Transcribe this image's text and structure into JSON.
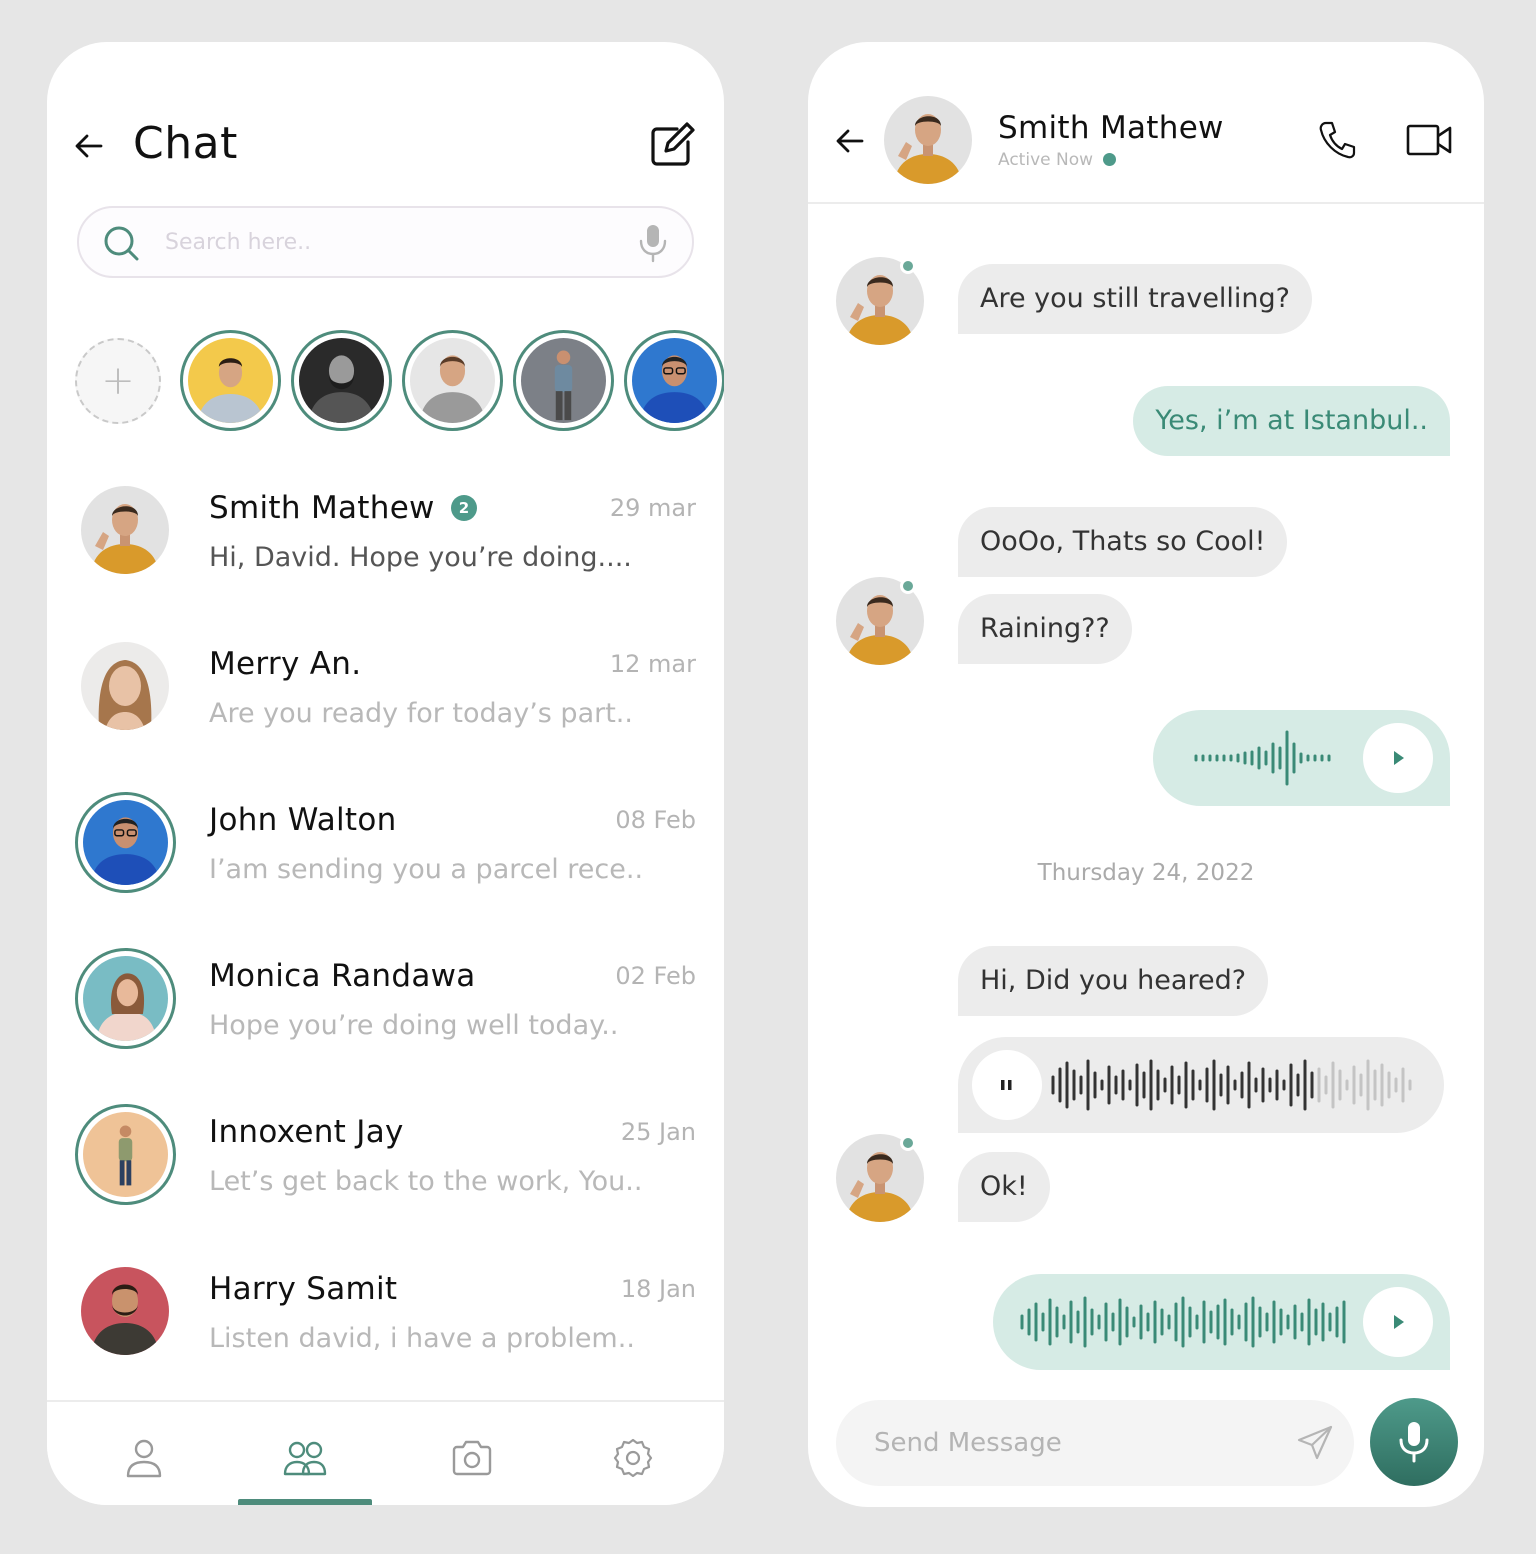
{
  "left": {
    "title": "Chat",
    "search": {
      "placeholder": "Search here.."
    },
    "stories": [
      {
        "name": "story-1",
        "bg": "#f2c84a"
      },
      {
        "name": "story-2",
        "bg": "#3a3a3a"
      },
      {
        "name": "story-3",
        "bg": "#e3e3e3"
      },
      {
        "name": "story-4",
        "bg": "#7b7f85"
      },
      {
        "name": "story-5",
        "bg": "#3f8ee0"
      }
    ],
    "chats": [
      {
        "name": "Smith Mathew",
        "badge": "2",
        "date": "29 mar",
        "preview": "Hi, David. Hope you’re doing....",
        "unread": true
      },
      {
        "name": "Merry An.",
        "date": "12 mar",
        "preview": "Are you ready for today’s part.."
      },
      {
        "name": "John Walton",
        "date": "08 Feb",
        "preview": "I’am sending you a parcel rece.."
      },
      {
        "name": "Monica Randawa",
        "date": "02 Feb",
        "preview": "Hope you’re doing well today.."
      },
      {
        "name": "Innoxent Jay",
        "date": "25 Jan",
        "preview": "Let’s get back to the work, You.."
      },
      {
        "name": "Harry Samit",
        "date": "18 Jan",
        "preview": "Listen david, i have a problem.."
      }
    ],
    "tabs": [
      "profile-icon",
      "group-icon",
      "camera-icon",
      "settings-icon"
    ],
    "active_tab": "group-icon"
  },
  "right": {
    "contact_name": "Smith Mathew",
    "status": "Active Now",
    "messages": {
      "m1": "Are you still travelling?",
      "m2": "Yes, i’m at Istanbul..",
      "m3": "OoOo, Thats so Cool!",
      "m4": "Raining??",
      "m6": "Hi, Did you heared?",
      "m8": "Ok!"
    },
    "date_separator": "Thursday 24, 2022",
    "composer_placeholder": "Send Message"
  },
  "colors": {
    "accent": "#4e8c7c",
    "bubble_out": "#d6ebe5",
    "bubble_in": "#ececec",
    "background": "#e6e6e6"
  }
}
